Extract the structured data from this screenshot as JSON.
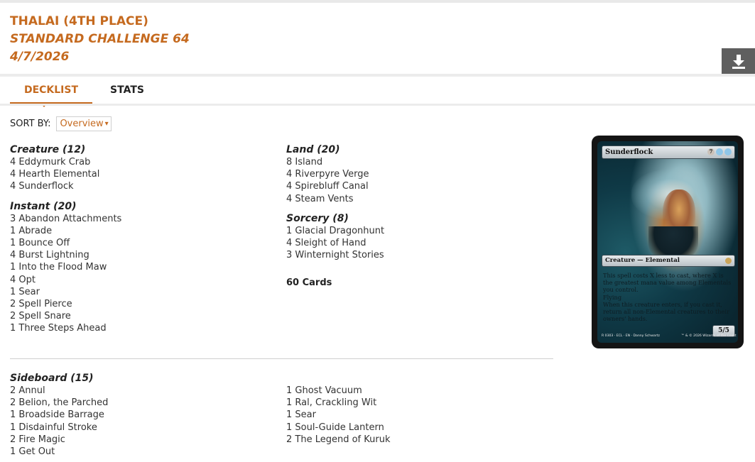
{
  "header": {
    "player": "THALAI (4TH PLACE)",
    "event": "STANDARD CHALLENGE 64",
    "date": "4/7/2026"
  },
  "toolbar": {
    "download_icon": "download-icon"
  },
  "tabs": [
    {
      "label": "DECKLIST",
      "active": true
    },
    {
      "label": "STATS",
      "active": false
    }
  ],
  "sort": {
    "label": "SORT BY:",
    "selected": "Overview"
  },
  "maindeck": {
    "left": [
      {
        "title": "Creature (12)",
        "cards": [
          "4 Eddymurk Crab",
          "4 Hearth Elemental",
          "4 Sunderflock"
        ]
      },
      {
        "title": "Instant (20)",
        "cards": [
          "3 Abandon Attachments",
          "1 Abrade",
          "1 Bounce Off",
          "4 Burst Lightning",
          "1 Into the Flood Maw",
          "4 Opt",
          "1 Sear",
          "2 Spell Pierce",
          "2 Spell Snare",
          "1 Three Steps Ahead"
        ]
      }
    ],
    "right": [
      {
        "title": "Land (20)",
        "cards": [
          "8 Island",
          "4 Riverpyre Verge",
          "4 Spirebluff Canal",
          "4 Steam Vents"
        ]
      },
      {
        "title": "Sorcery (8)",
        "cards": [
          "1 Glacial Dragonhunt",
          "4 Sleight of Hand",
          "3 Winternight Stories"
        ]
      }
    ],
    "total": "60 Cards"
  },
  "sideboard": {
    "title": "Sideboard (15)",
    "left": [
      "2 Annul",
      "2 Belion, the Parched",
      "1 Broadside Barrage",
      "1 Disdainful Stroke",
      "2 Fire Magic",
      "1 Get Out"
    ],
    "right": [
      "1 Ghost Vacuum",
      "1 Ral, Crackling Wit",
      "1 Sear",
      "1 Soul-Guide Lantern",
      "2 The Legend of Kuruk"
    ]
  },
  "card_preview": {
    "name": "Sunderflock",
    "cost_generic": "7",
    "type_line": "Creature — Elemental",
    "rules": [
      "This spell costs X less to cast, where X is the greatest mana value among Elementals you control.",
      "Flying",
      "When this creature enters, if you cast it, return all non-Elemental creatures to their owners' hands."
    ],
    "pt": "5/5",
    "collector_left": "R 0303 · ECL · EN · Danny Schwartz",
    "collector_right": "™ & © 2026 Wizards of the Coast"
  },
  "colors": {
    "accent": "#c56a1f",
    "text": "#333333",
    "download_bg": "#5f5f5f"
  }
}
